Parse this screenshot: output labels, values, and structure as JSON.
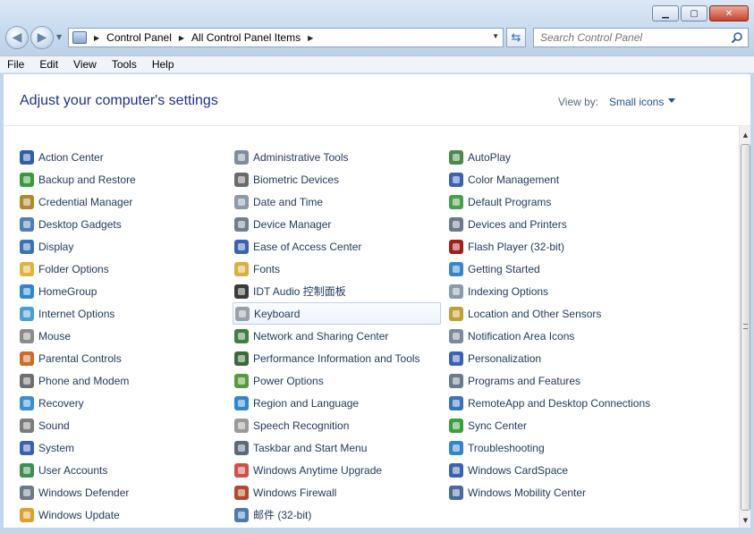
{
  "window": {
    "minimize_glyph": "▁",
    "maximize_glyph": "▢",
    "close_glyph": "✕"
  },
  "address": {
    "crumbs": [
      "Control Panel",
      "All Control Panel Items"
    ],
    "separator_glyph": "▶",
    "dropdown_glyph": "▼"
  },
  "search": {
    "placeholder": "Search Control Panel"
  },
  "menu": [
    "File",
    "Edit",
    "View",
    "Tools",
    "Help"
  ],
  "page": {
    "title": "Adjust your computer's settings",
    "view_by_label": "View by:",
    "view_by_value": "Small icons"
  },
  "columns": [
    [
      {
        "label": "Action Center",
        "color": "#2f5fa8"
      },
      {
        "label": "Backup and Restore",
        "color": "#3a9a3a"
      },
      {
        "label": "Credential Manager",
        "color": "#b08a2e"
      },
      {
        "label": "Desktop Gadgets",
        "color": "#4f7fb8"
      },
      {
        "label": "Display",
        "color": "#3a72b8"
      },
      {
        "label": "Folder Options",
        "color": "#e0b43c"
      },
      {
        "label": "HomeGroup",
        "color": "#2f86c8"
      },
      {
        "label": "Internet Options",
        "color": "#4aa0d0"
      },
      {
        "label": "Mouse",
        "color": "#8c8c8c"
      },
      {
        "label": "Parental Controls",
        "color": "#d06a2a"
      },
      {
        "label": "Phone and Modem",
        "color": "#6f6f6f"
      },
      {
        "label": "Recovery",
        "color": "#3a8fd0"
      },
      {
        "label": "Sound",
        "color": "#7c7c7c"
      },
      {
        "label": "System",
        "color": "#3a62b0"
      },
      {
        "label": "User Accounts",
        "color": "#3f8f4f"
      },
      {
        "label": "Windows Defender",
        "color": "#6a7a8a"
      },
      {
        "label": "Windows Update",
        "color": "#e0a030"
      }
    ],
    [
      {
        "label": "Administrative Tools",
        "color": "#7e8ea0"
      },
      {
        "label": "Biometric Devices",
        "color": "#6a6a6a"
      },
      {
        "label": "Date and Time",
        "color": "#8a9aaa"
      },
      {
        "label": "Device Manager",
        "color": "#6f7f8f"
      },
      {
        "label": "Ease of Access Center",
        "color": "#3a62b0"
      },
      {
        "label": "Fonts",
        "color": "#d8b040"
      },
      {
        "label": "IDT Audio 控制面板",
        "color": "#3a3a3a"
      },
      {
        "label": "Keyboard",
        "color": "#9aa0a8",
        "selected": true
      },
      {
        "label": "Network and Sharing Center",
        "color": "#3f7f3f"
      },
      {
        "label": "Performance Information and Tools",
        "color": "#3a6a3a"
      },
      {
        "label": "Power Options",
        "color": "#5a9a3a"
      },
      {
        "label": "Region and Language",
        "color": "#2f86c8"
      },
      {
        "label": "Speech Recognition",
        "color": "#9a9a9a"
      },
      {
        "label": "Taskbar and Start Menu",
        "color": "#5a6a7a"
      },
      {
        "label": "Windows Anytime Upgrade",
        "color": "#d0504a"
      },
      {
        "label": "Windows Firewall",
        "color": "#b04a2a"
      },
      {
        "label": "邮件 (32-bit)",
        "color": "#4a7ab0"
      }
    ],
    [
      {
        "label": "AutoPlay",
        "color": "#4a8a4a"
      },
      {
        "label": "Color Management",
        "color": "#3a62b0"
      },
      {
        "label": "Default Programs",
        "color": "#4aa04a"
      },
      {
        "label": "Devices and Printers",
        "color": "#6a7a8a"
      },
      {
        "label": "Flash Player (32-bit)",
        "color": "#a0201a"
      },
      {
        "label": "Getting Started",
        "color": "#3a86c8"
      },
      {
        "label": "Indexing Options",
        "color": "#8a9aaa"
      },
      {
        "label": "Location and Other Sensors",
        "color": "#c0a030"
      },
      {
        "label": "Notification Area Icons",
        "color": "#7a8a9a"
      },
      {
        "label": "Personalization",
        "color": "#3a62b0"
      },
      {
        "label": "Programs and Features",
        "color": "#6a7a8a"
      },
      {
        "label": "RemoteApp and Desktop Connections",
        "color": "#3a72b8"
      },
      {
        "label": "Sync Center",
        "color": "#3aa03a"
      },
      {
        "label": "Troubleshooting",
        "color": "#2f86c8"
      },
      {
        "label": "Windows CardSpace",
        "color": "#3a62b0"
      },
      {
        "label": "Windows Mobility Center",
        "color": "#4a6a9a"
      }
    ]
  ],
  "scrollbar": {
    "up_glyph": "▲",
    "down_glyph": "▼"
  }
}
